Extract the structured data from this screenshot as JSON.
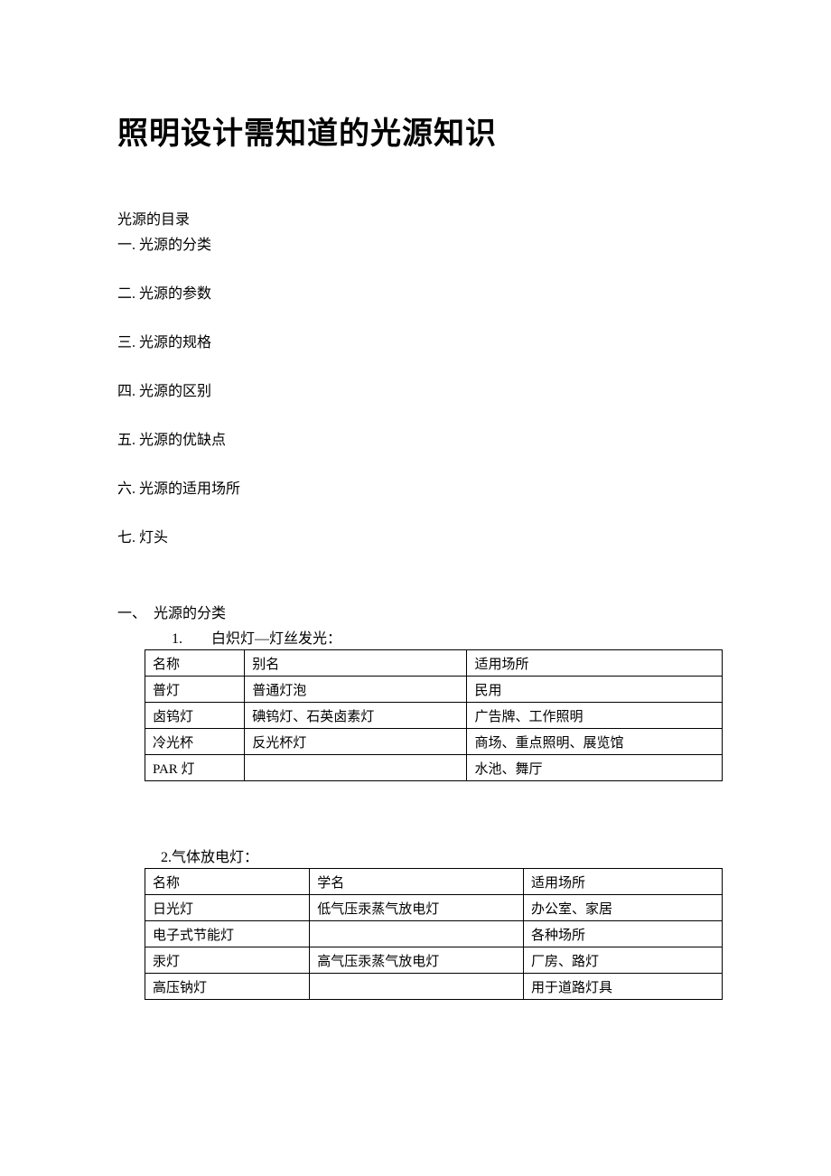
{
  "title": "照明设计需知道的光源知识",
  "toc": {
    "heading": "光源的目录",
    "items": [
      "一. 光源的分类",
      "二. 光源的参数",
      "三. 光源的规格",
      "四. 光源的区别",
      "五. 光源的优缺点",
      "六. 光源的适用场所",
      "七. 灯头"
    ]
  },
  "section1": {
    "heading": "一、　光源的分类",
    "sub1": {
      "heading": "1.　　白炽灯—灯丝发光：",
      "headers": [
        "名称",
        "别名",
        "适用场所"
      ],
      "rows": [
        [
          "普灯",
          "普通灯泡",
          "民用"
        ],
        [
          "卤钨灯",
          "碘钨灯、石英卤素灯",
          "广告牌、工作照明"
        ],
        [
          "冷光杯",
          "反光杯灯",
          "商场、重点照明、展览馆"
        ],
        [
          "PAR 灯",
          "",
          "水池、舞厅"
        ]
      ]
    },
    "sub2": {
      "heading": "2.气体放电灯：",
      "headers": [
        "名称",
        "学名",
        "适用场所"
      ],
      "rows": [
        [
          "日光灯",
          "低气压汞蒸气放电灯",
          "办公室、家居"
        ],
        [
          "电子式节能灯",
          "",
          "各种场所"
        ],
        [
          "汞灯",
          "高气压汞蒸气放电灯",
          "厂房、路灯"
        ],
        [
          "高压钠灯",
          "",
          "用于道路灯具"
        ]
      ]
    }
  }
}
